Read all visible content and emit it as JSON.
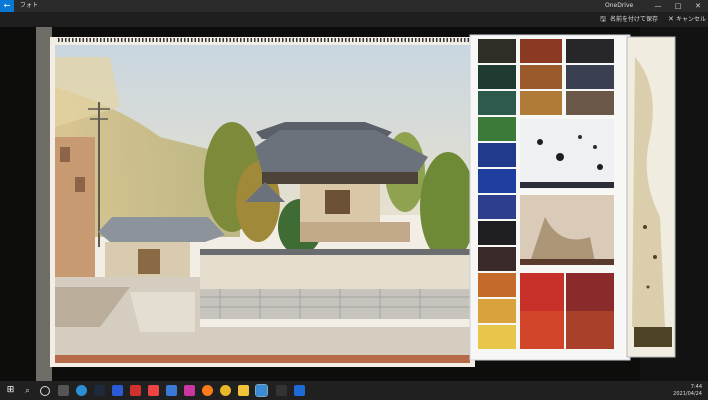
{
  "titlebar": {
    "app_title": "フォト",
    "onedrive": "OneDrive"
  },
  "cmdbar": {
    "save_label": "名前を付けて保存",
    "cancel_label": "キャンセル"
  },
  "taskbar": {
    "time": "7:44",
    "date": "2021/04/24"
  }
}
